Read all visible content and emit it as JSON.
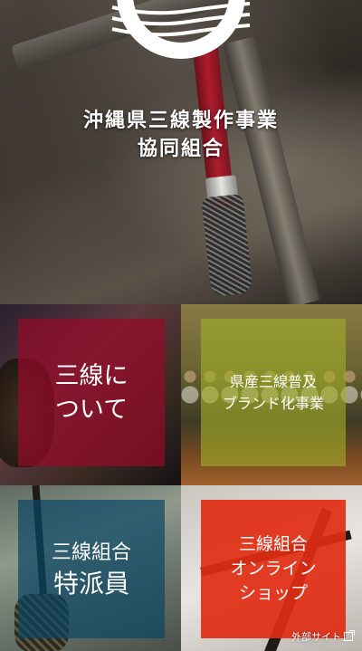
{
  "hero": {
    "title_line1": "沖縄県三線製作事業",
    "title_line2": "協同組合"
  },
  "tiles": [
    {
      "line1": "三線に",
      "line2": "ついて"
    },
    {
      "line1": "県産三線普及",
      "line2": "ブランド化事業"
    },
    {
      "line1": "三線組合",
      "line2": "特派員"
    },
    {
      "line1": "三線組合",
      "line2": "オンライン",
      "line3": "ショップ",
      "external_label": "外部サイト"
    }
  ],
  "colors": {
    "tile1_panel": "#96102a",
    "tile2_panel": "#a0af28",
    "tile3_panel": "#0a4664",
    "tile4_panel": "#e12d14"
  }
}
